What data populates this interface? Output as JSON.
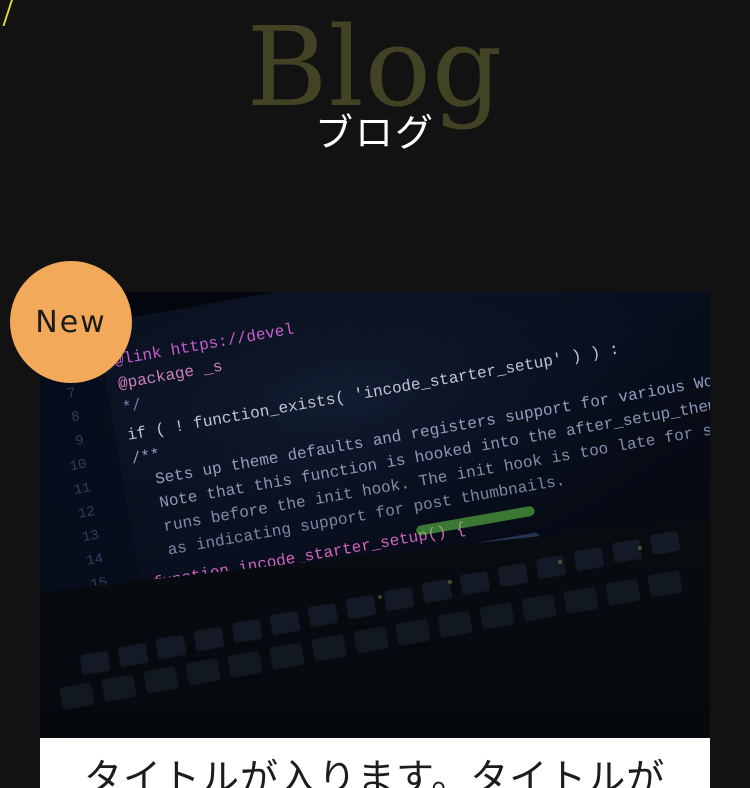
{
  "section": {
    "background_word": "Blog",
    "title": "ブログ"
  },
  "badge": {
    "label": "New"
  },
  "card": {
    "title": "タイトルが入ります。タイトルが"
  },
  "thumbnail": {
    "image_text": {
      "line_link": "@link https://devel",
      "line_package": "@package _s",
      "line_if": "if ( ! function_exists( 'incode_starter_setup' ) ) :",
      "line_doc1": "Sets up theme defaults and registers support for various WordPress features.",
      "line_doc2": "Note that this function is hooked into the after_setup_theme hook, which",
      "line_doc3": "runs before the init hook. The init hook is too late for some features, such",
      "line_doc4": "as indicating support for post thumbnails.",
      "line_func": "function incode_starter_setup() {"
    }
  },
  "colors": {
    "page_bg": "#121212",
    "bg_word": "#787840",
    "title": "#ffffff",
    "badge_bg": "#f2a95a",
    "card_bg": "#ffffff",
    "accent_line": "#e8e33a"
  }
}
